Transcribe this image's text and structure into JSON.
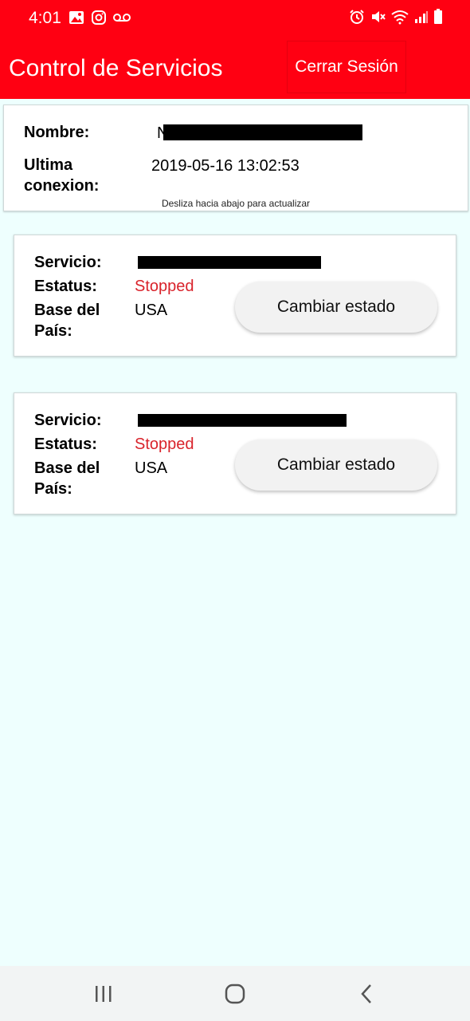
{
  "status_bar": {
    "time": "4:01",
    "left_icons": [
      "image-icon",
      "instagram-icon",
      "voicemail-icon"
    ],
    "right_icons": [
      "alarm-icon",
      "mute-icon",
      "wifi-icon",
      "signal-icon",
      "battery-icon"
    ]
  },
  "app_bar": {
    "title": "Control de Servicios",
    "logout_label": "Cerrar Sesión",
    "color": "#ff0012"
  },
  "user_info": {
    "name_label": "Nombre:",
    "name_value": "N",
    "last_conn_label_1": "Ultima",
    "last_conn_label_2": "conexion:",
    "last_conn_value": "2019-05-16 13:02:53",
    "refresh_hint": "Desliza hacia abajo para actualizar"
  },
  "services": [
    {
      "service_label": "Servicio:",
      "service_value": "",
      "status_label": "Estatus:",
      "status_value": "Stopped",
      "country_label_1": "Base del",
      "country_label_2": "País:",
      "country_value": "USA",
      "button_label": "Cambiar estado"
    },
    {
      "service_label": "Servicio:",
      "service_value": "",
      "status_label": "Estatus:",
      "status_value": "Stopped",
      "country_label_1": "Base del",
      "country_label_2": "País:",
      "country_value": "USA",
      "button_label": "Cambiar estado"
    }
  ],
  "nav_bar": {
    "buttons": [
      "recent-apps-icon",
      "home-icon",
      "back-icon"
    ]
  },
  "colors": {
    "accent": "#ff0012",
    "stopped": "#d9232b",
    "background": "#eefffe"
  }
}
